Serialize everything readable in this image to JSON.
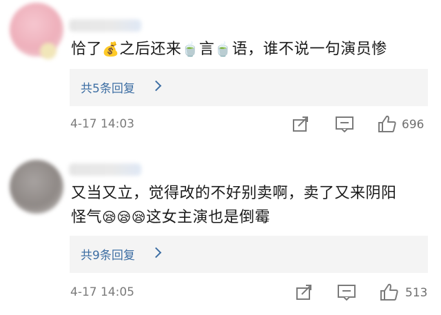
{
  "comments": [
    {
      "text_parts": [
        "恰了",
        "💰",
        "之后还来",
        "🍵",
        "言",
        "🍵",
        "语，谁不说一句演员惨"
      ],
      "reply_label": "共5条回复",
      "time": "4-17 14:03",
      "like_count": "696"
    },
    {
      "text_line1": "又当又立，觉得改的不好别卖啊，卖了又来阴阳",
      "text_line2_parts": [
        "怪气",
        "😪😪😪",
        "这女主演也是倒霉"
      ],
      "reply_label": "共9条回复",
      "time": "4-17 14:05",
      "like_count": "513"
    }
  ],
  "icons": [
    "share-icon",
    "comment-icon",
    "like-icon"
  ]
}
